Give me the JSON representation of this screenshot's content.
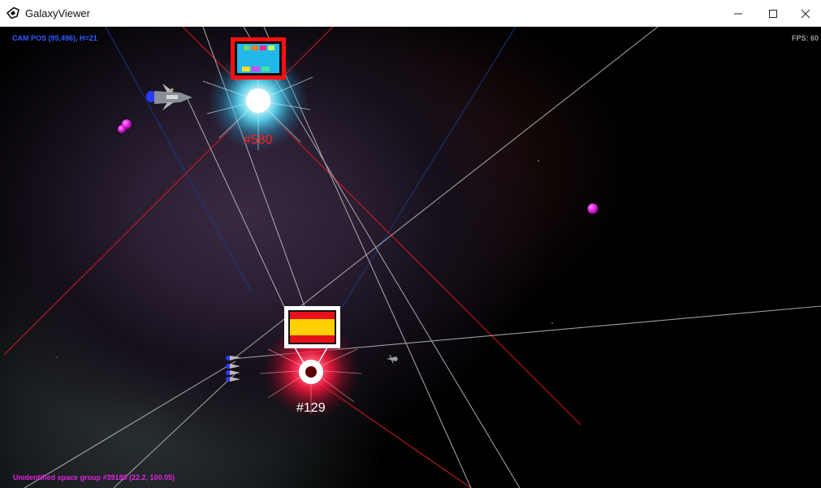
{
  "window": {
    "title": "GalaxyViewer",
    "controls": [
      "minimize-icon",
      "maximize-icon",
      "close-icon"
    ]
  },
  "hud": {
    "cam_pos": "CAM POS (95,496), H=21",
    "fps": "FPS: 60",
    "status": "Unidentified space group #39188 (22.2, 100.05)"
  },
  "systems": [
    {
      "id": "#580",
      "color": "#ff2020",
      "star_color": "#5ee3ff",
      "flag": "multicolor-flag"
    },
    {
      "id": "#129",
      "color": "#ffffff",
      "star_color": "#ff1a40",
      "flag": "spain-flag"
    }
  ],
  "colors": {
    "cam_text": "#2f5cff",
    "fps_text": "#9c9c9c",
    "status_text": "#e021e0",
    "route_white": "#b8b8b8",
    "route_red": "#cc1a1a",
    "route_blue": "#1a3c9a",
    "planet": "#e020e0"
  }
}
